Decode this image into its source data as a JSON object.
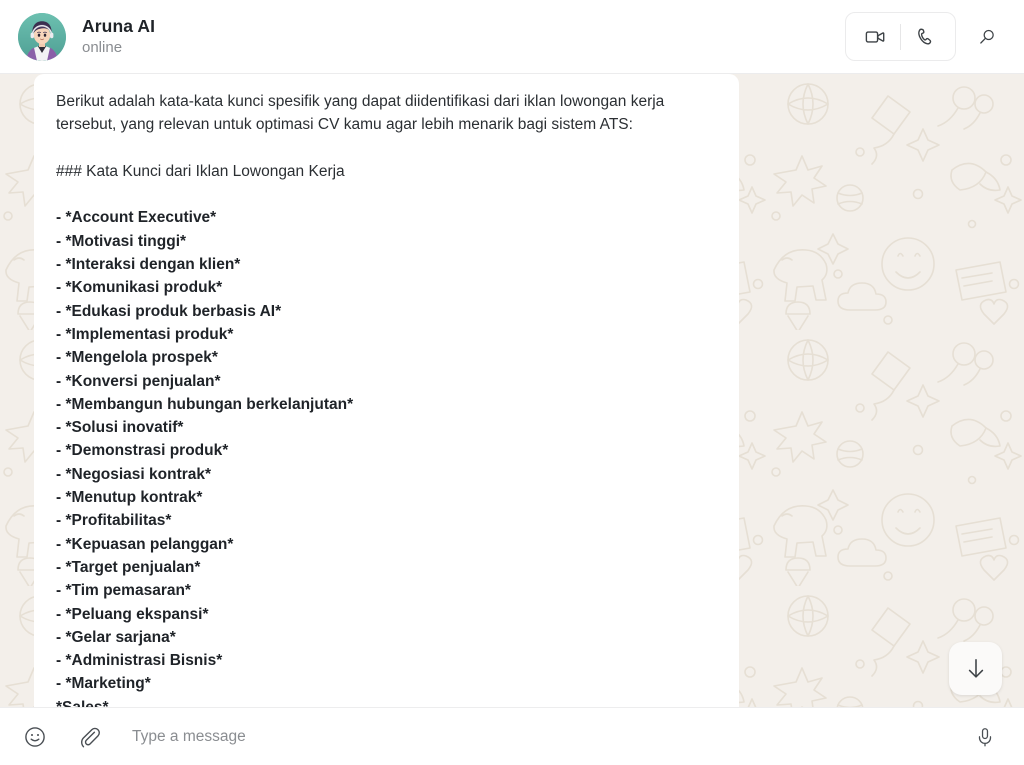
{
  "header": {
    "contact_name": "Aruna AI",
    "status": "online",
    "avatar_alt": "avatar",
    "video_call_icon": "video-camera-icon",
    "voice_call_icon": "phone-icon",
    "search_icon": "search-icon"
  },
  "message": {
    "paragraph_1": "Berikut adalah kata-kata kunci spesifik yang dapat diidentifikasi dari iklan lowongan kerja tersebut, yang relevan untuk optimasi CV kamu agar lebih menarik bagi sistem ATS:",
    "heading": "### Kata Kunci dari Iklan Lowongan Kerja",
    "items": [
      "- *Account Executive*",
      "- *Motivasi tinggi*",
      "- *Interaksi dengan klien*",
      "- *Komunikasi produk*",
      "- *Edukasi produk berbasis AI*",
      "- *Implementasi produk*",
      "- *Mengelola prospek*",
      "- *Konversi penjualan*",
      "- *Membangun hubungan berkelanjutan*",
      "- *Solusi inovatif*",
      "- *Demonstrasi produk*",
      "- *Negosiasi kontrak*",
      "- *Menutup kontrak*",
      "- *Profitabilitas*",
      "- *Kepuasan pelanggan*",
      "- *Target penjualan*",
      "- *Tim pemasaran*",
      "- *Peluang ekspansi*",
      "- *Gelar sarjana*",
      "- *Administrasi Bisnis*",
      "- *Marketing*",
      "  *Sales*"
    ]
  },
  "scroll_button": {
    "icon": "arrow-down-icon"
  },
  "input_bar": {
    "emoji_icon": "smiley-icon",
    "attach_icon": "paperclip-icon",
    "placeholder": "Type a message",
    "value": "",
    "mic_icon": "microphone-icon"
  },
  "colors": {
    "chat_background": "#f3efea",
    "doodle": "#e9e3da",
    "bubble": "#ffffff",
    "header_background": "#ffffff",
    "text_primary": "#2b2f33",
    "text_secondary": "#8a8d91"
  }
}
